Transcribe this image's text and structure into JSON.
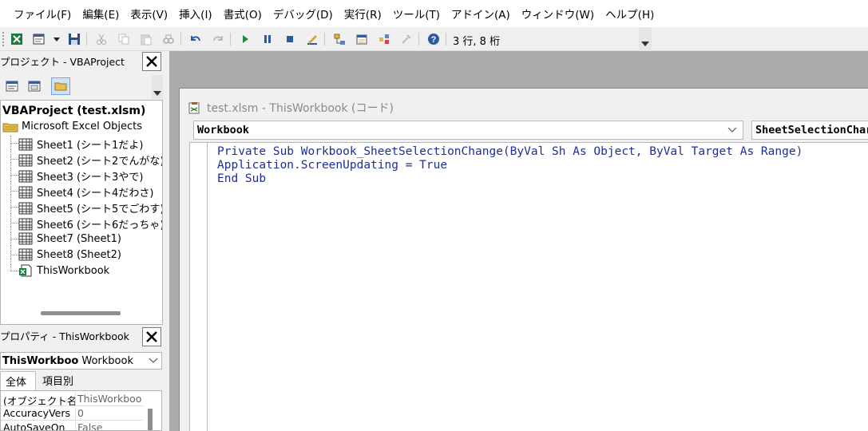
{
  "menu": [
    "ファイル(F)",
    "編集(E)",
    "表示(V)",
    "挿入(I)",
    "書式(O)",
    "デバッグ(D)",
    "実行(R)",
    "ツール(T)",
    "アドイン(A)",
    "ウィンドウ(W)",
    "ヘルプ(H)"
  ],
  "toolbar": {
    "position_label": "3 行, 8 桁",
    "icons": [
      "excel-icon",
      "insert-module-icon",
      "dropdown-icon",
      "save-icon",
      "cut-icon",
      "copy-icon",
      "paste-icon",
      "find-icon",
      "undo-icon",
      "redo-icon",
      "run-icon",
      "break-icon",
      "reset-icon",
      "design-mode-icon",
      "project-explorer-icon",
      "properties-window-icon",
      "object-browser-icon",
      "toolbox-icon",
      "help-icon"
    ]
  },
  "project_pane": {
    "title": "プロジェクト - VBAProject",
    "root": "VBAProject (test.xlsm)",
    "folder": "Microsoft Excel Objects",
    "items": [
      "Sheet1 (シート1だよ)",
      "Sheet2 (シート2でんがな)",
      "Sheet3 (シート3やで)",
      "Sheet4 (シート4だわさ)",
      "Sheet5 (シート5でごわす)",
      "Sheet6 (シート6だっちゃ)",
      "Sheet7 (Sheet1)",
      "Sheet8 (Sheet2)",
      "ThisWorkbook"
    ],
    "highlight_color": "#e0201c"
  },
  "properties_pane": {
    "title": "プロパティ - ThisWorkbook",
    "combo_name": "ThisWorkboo",
    "combo_type": "Workbook",
    "tabs": [
      "全体",
      "項目別"
    ],
    "rows": [
      {
        "name": "(オブジェクト名)",
        "value": "ThisWorkboo"
      },
      {
        "name": "AccuracyVers",
        "value": "0"
      },
      {
        "name": "AutoSaveOn",
        "value": "False"
      }
    ]
  },
  "code_window": {
    "title": "test.xlsm - ThisWorkbook (コード)",
    "object_combo": "Workbook",
    "procedure_combo": "SheetSelectionChar",
    "lines": [
      "Private Sub Workbook_SheetSelectionChange(ByVal Sh As Object, ByVal Target As Range)",
      "Application.ScreenUpdating = True",
      "End Sub"
    ],
    "code_color": "#1f2d9a"
  }
}
